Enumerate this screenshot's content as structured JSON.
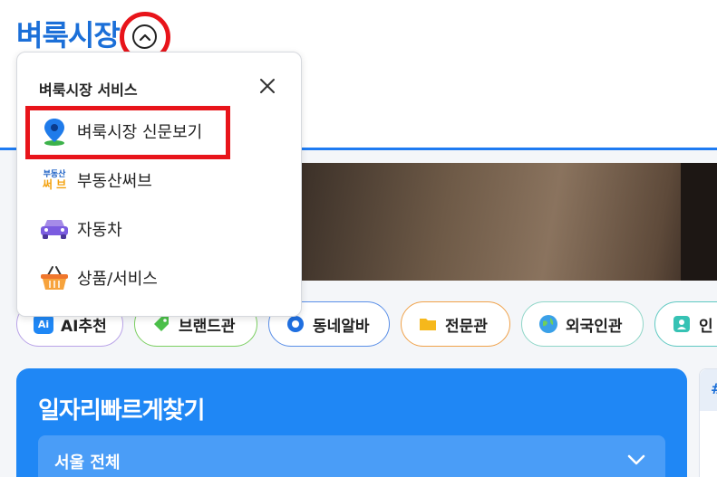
{
  "header": {
    "logo": "벼룩시장"
  },
  "dropdown": {
    "title": "벼룩시장 서비스",
    "items": [
      {
        "label": "벼룩시장 신문보기",
        "icon": "map-pin-icon"
      },
      {
        "label": "부동산써브",
        "icon": "realestate-serve-logo-icon",
        "logo_text_top": "부동산",
        "logo_text_bottom": "써 브"
      },
      {
        "label": "자동차",
        "icon": "car-icon"
      },
      {
        "label": "상품/서비스",
        "icon": "basket-icon"
      }
    ]
  },
  "chips": [
    {
      "label": "AI추천",
      "icon": "ai-icon",
      "icon_text": "Ai",
      "border": "#b9a3e8"
    },
    {
      "label": "브랜드관",
      "icon": "tag-icon",
      "border": "#7ccf62"
    },
    {
      "label": "동네알바",
      "icon": "location-dot-icon",
      "border": "#5a8fe8"
    },
    {
      "label": "전문관",
      "icon": "folder-icon",
      "border": "#f0a24a"
    },
    {
      "label": "외국인관",
      "icon": "globe-icon",
      "border": "#8fd6c8"
    },
    {
      "label": "인",
      "icon": "person-badge-icon",
      "border": "#5fc9c2"
    }
  ],
  "jobs": {
    "title": "일자리빠르게찾기",
    "region": "서울 전체"
  },
  "side_card": {
    "header": "#"
  },
  "colors": {
    "brand": "#1b6fd8",
    "accent_blue": "#1f87f5",
    "highlight_red": "#e8141a"
  }
}
